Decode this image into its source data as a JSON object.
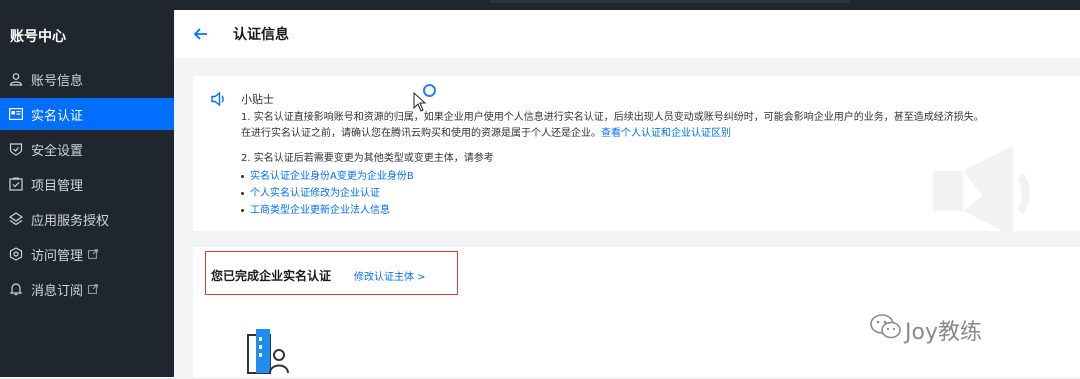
{
  "sidebar": {
    "title": "账号中心",
    "items": [
      {
        "label": "账号信息"
      },
      {
        "label": "实名认证"
      },
      {
        "label": "安全设置"
      },
      {
        "label": "项目管理"
      },
      {
        "label": "应用服务授权"
      },
      {
        "label": "访问管理"
      },
      {
        "label": "消息订阅"
      }
    ]
  },
  "header": {
    "title": "认证信息"
  },
  "notice": {
    "title": "小贴士",
    "line1": "1. 实名认证直接影响账号和资源的归属，如果企业用户使用个人信息进行实名认证，后续出现人员变动或账号纠纷时，可能会影响企业用户的业务，甚至造成经济损失。",
    "line2_text": "在进行实名认证之前，请确认您在腾讯云购买和使用的资源是属于个人还是企业。",
    "line2_link": "查看个人认证和企业认证区别",
    "line3": "2. 实名认证后若需要变更为其他类型或变更主体，请参考",
    "links": [
      "实名认证企业身份A变更为企业身份B",
      "个人实名认证修改为企业认证",
      "工商类型企业更新企业法人信息"
    ]
  },
  "status": {
    "title": "您已完成企业实名认证",
    "modify_link": "修改认证主体 >"
  },
  "watermark": {
    "text": "Joy教练"
  },
  "colors": {
    "sidebar_bg": "#20262f",
    "accent": "#006eff",
    "highlight_border": "#e5363a"
  }
}
